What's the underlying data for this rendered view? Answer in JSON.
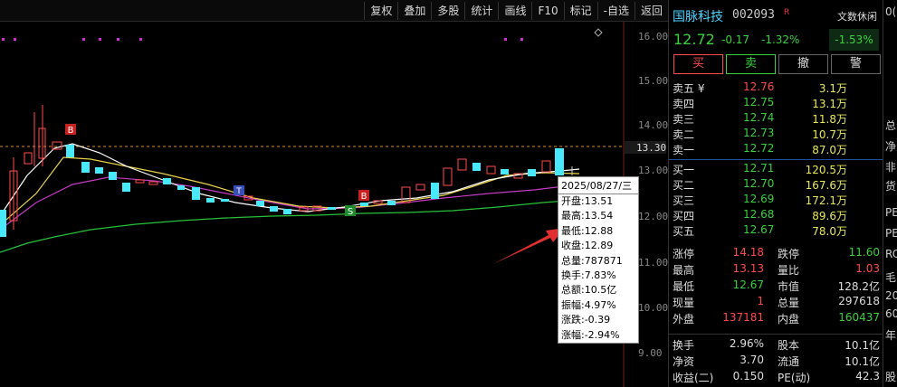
{
  "toolbar": {
    "buttons": [
      "复权",
      "叠加",
      "多股",
      "统计",
      "画线",
      "F10",
      "标记",
      "-自选",
      "返回"
    ]
  },
  "chart": {
    "price_axis": [
      "16.00",
      "15.00",
      "14.00",
      "13.00",
      "12.00",
      "11.00",
      "10.00",
      "9.00"
    ],
    "price_axis_highlight": "13.30",
    "markers": {
      "b1": "B",
      "b2": "B",
      "s1": "S",
      "t1": "T"
    }
  },
  "tooltip": {
    "date": "2025/08/27/三",
    "lines": [
      "开盘:13.51",
      "最高:13.54",
      "最低:12.88",
      "收盘:12.89",
      "总量:787871",
      "换手:7.83%",
      "总额:10.5亿",
      "振幅:4.97%",
      "涨跌:-0.39",
      "涨幅:-2.94%"
    ]
  },
  "quote": {
    "name": "国脉科技",
    "code": "002093",
    "tag": "R",
    "news_label": "文数休闲",
    "price": "12.72",
    "change": "-0.17",
    "change_pct": "-1.32%",
    "index_pct": "-1.53%",
    "buttons": {
      "buy": "买",
      "sell": "卖",
      "cancel": "撤",
      "alert": "警"
    }
  },
  "order_book": {
    "asks": [
      {
        "label": "卖五 ¥",
        "price": "12.76",
        "vol": "3.1万"
      },
      {
        "label": "卖四",
        "price": "12.75",
        "vol": "13.1万"
      },
      {
        "label": "卖三",
        "price": "12.74",
        "vol": "11.8万"
      },
      {
        "label": "卖二",
        "price": "12.73",
        "vol": "10.7万"
      },
      {
        "label": "卖一",
        "price": "12.72",
        "vol": "87.0万"
      }
    ],
    "bids": [
      {
        "label": "买一",
        "price": "12.71",
        "vol": "120.5万"
      },
      {
        "label": "买二",
        "price": "12.70",
        "vol": "167.6万"
      },
      {
        "label": "买三",
        "price": "12.69",
        "vol": "172.1万"
      },
      {
        "label": "买四",
        "price": "12.68",
        "vol": "89.6万"
      },
      {
        "label": "买五",
        "price": "12.67",
        "vol": "78.0万"
      }
    ]
  },
  "stats1": [
    {
      "l1": "涨停",
      "v1": "14.18",
      "l2": "跌停",
      "v2": "11.60"
    },
    {
      "l1": "最高",
      "v1": "13.13",
      "l2": "量比",
      "v2": "1.03"
    },
    {
      "l1": "最低",
      "v1": "12.67",
      "l2": "市值",
      "v2": "128.2亿"
    },
    {
      "l1": "现量",
      "v1": "1",
      "l2": "总量",
      "v2": "297618"
    },
    {
      "l1": "外盘",
      "v1": "137181",
      "l2": "内盘",
      "v2": "160437"
    }
  ],
  "stats2": [
    {
      "l1": "换手",
      "v1": "2.96%",
      "l2": "股本",
      "v2": "10.1亿"
    },
    {
      "l1": "净资",
      "v1": "3.70",
      "l2": "流通",
      "v2": "10.1亿"
    },
    {
      "l1": "收益(二)",
      "v1": "0.150",
      "l2": "PE(动)",
      "v2": "42.3"
    }
  ],
  "edge_chars": [
    "0(",
    "总",
    "净",
    "非",
    "货",
    "PE",
    "PE",
    "RC",
    "20",
    "60",
    "毛",
    "年",
    "股"
  ],
  "colors": {
    "up": "#ff4b4b",
    "down": "#38d13c",
    "accent": "#4ad4ff",
    "volume": "#e8e85a"
  }
}
